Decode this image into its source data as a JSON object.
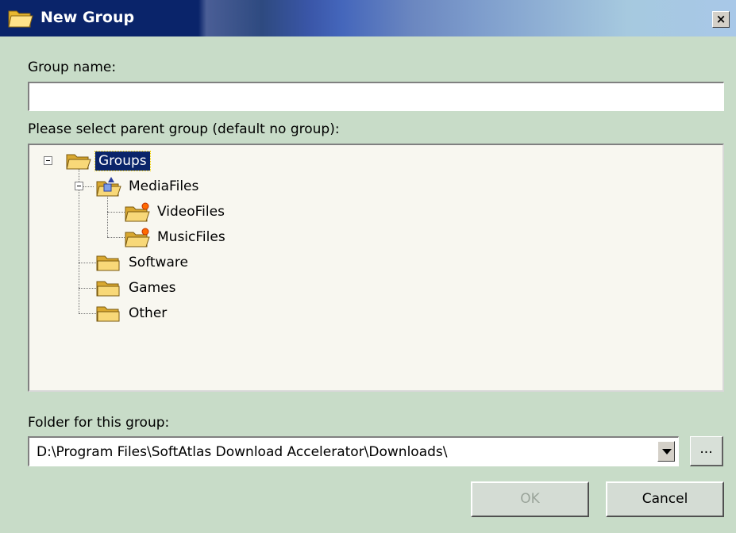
{
  "window": {
    "title": "New Group",
    "close_label": "×"
  },
  "group_name": {
    "label": "Group name:",
    "value": ""
  },
  "parent_group": {
    "label": "Please select parent group (default no group):",
    "tree": {
      "root": "Groups",
      "media": "MediaFiles",
      "video": "VideoFiles",
      "music": "MusicFiles",
      "software": "Software",
      "games": "Games",
      "other": "Other"
    }
  },
  "folder": {
    "label": "Folder for this group:",
    "value": "D:\\Program Files\\SoftAtlas Download Accelerator\\Downloads\\",
    "browse_label": "..."
  },
  "buttons": {
    "ok": "OK",
    "cancel": "Cancel"
  },
  "colors": {
    "selection": "#0a246a",
    "dialog_bg": "#c8dcc8",
    "folder": "#f2d06a"
  }
}
